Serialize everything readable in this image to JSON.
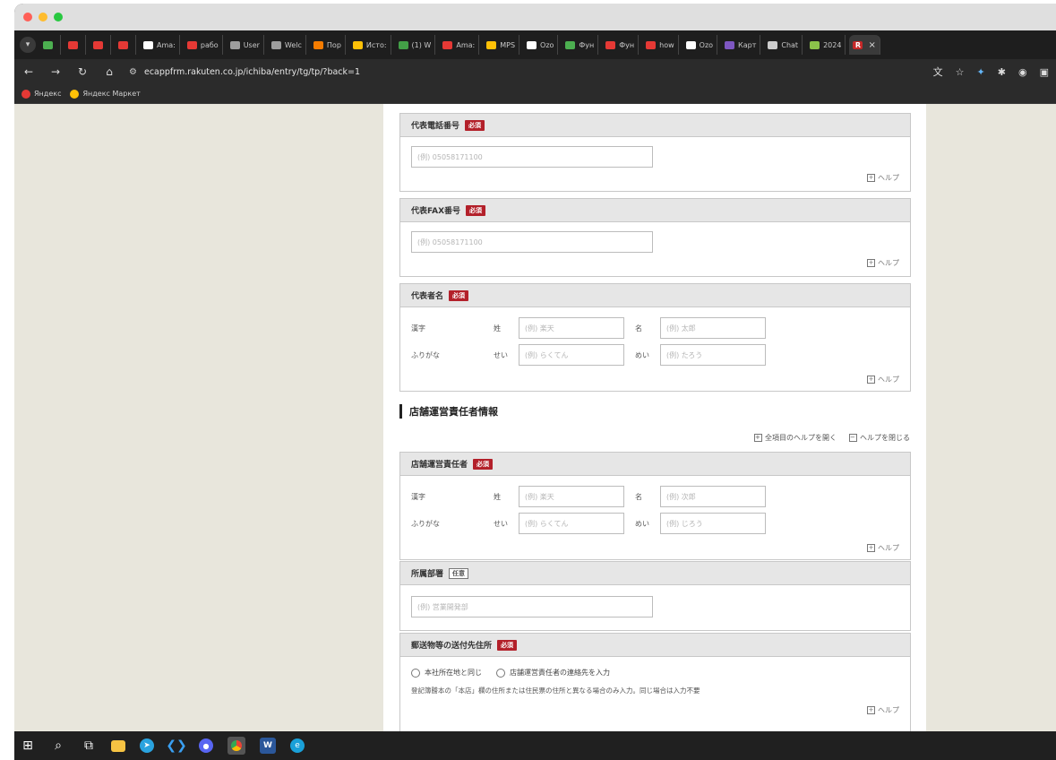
{
  "browser": {
    "tabs": [
      {
        "label": "",
        "color": "#4caf50"
      },
      {
        "label": "",
        "color": "#e53935"
      },
      {
        "label": "",
        "color": "#e53935"
      },
      {
        "label": "",
        "color": "#e53935"
      },
      {
        "label": "Ama:",
        "color": "#ffffff"
      },
      {
        "label": "рабо",
        "color": "#e53935"
      },
      {
        "label": "User",
        "color": "#9e9e9e"
      },
      {
        "label": "Welc",
        "color": "#9e9e9e"
      },
      {
        "label": "Пор",
        "color": "#f57c00"
      },
      {
        "label": "Исто:",
        "color": "#ffc107"
      },
      {
        "label": "(1) W",
        "color": "#43a047"
      },
      {
        "label": "Ama:",
        "color": "#e53935"
      },
      {
        "label": "MPS",
        "color": "#ffc107"
      },
      {
        "label": "Ozo",
        "color": "#ffffff"
      },
      {
        "label": "Фун",
        "color": "#4caf50"
      },
      {
        "label": "Фун",
        "color": "#e53935"
      },
      {
        "label": "how",
        "color": "#e53935"
      },
      {
        "label": "Ozo",
        "color": "#ffffff"
      },
      {
        "label": "Карт",
        "color": "#7e57c2"
      },
      {
        "label": "Chat",
        "color": "#cccccc"
      },
      {
        "label": "2024",
        "color": "#8bc34a"
      }
    ],
    "active_tab": {
      "label": "R",
      "color": "#c62828",
      "close": "×"
    },
    "url": "ecappfrm.rakuten.co.jp/ichiba/entry/tg/tp/?back=1",
    "bookmarks": [
      {
        "label": "Яндекс",
        "color": "#e53935"
      },
      {
        "label": "Яндекс Маркет",
        "color": "#ffc107"
      }
    ]
  },
  "form": {
    "phone": {
      "label": "代表電話番号",
      "badge": "必須",
      "placeholder": "(例) 05058171100",
      "help": "ヘルプ"
    },
    "fax": {
      "label": "代表FAX番号",
      "badge": "必須",
      "placeholder": "(例) 05058171100",
      "help": "ヘルプ"
    },
    "rep": {
      "label": "代表者名",
      "badge": "必須",
      "kanji_label": "漢字",
      "kana_label": "ふりがな",
      "sei": "姓",
      "mei": "名",
      "sei_kana": "せい",
      "mei_kana": "めい",
      "sei_ph": "(例) 楽天",
      "mei_ph": "(例) 太郎",
      "sei_kana_ph": "(例) らくてん",
      "mei_kana_ph": "(例) たろう",
      "help": "ヘルプ"
    },
    "section_title": "店舗運営責任者情報",
    "open_all": "全項目のヘルプを開く",
    "close_all": "ヘルプを閉じる",
    "manager": {
      "label": "店舗運営責任者",
      "badge": "必須",
      "kanji_label": "漢字",
      "kana_label": "ふりがな",
      "sei": "姓",
      "mei": "名",
      "sei_kana": "せい",
      "mei_kana": "めい",
      "sei_ph": "(例) 楽天",
      "mei_ph": "(例) 次郎",
      "sei_kana_ph": "(例) らくてん",
      "mei_kana_ph": "(例) じろう",
      "help": "ヘルプ"
    },
    "dept": {
      "label": "所属部署",
      "badge": "任意",
      "placeholder": "(例) 営業開発部"
    },
    "mail": {
      "label": "郵送物等の送付先住所",
      "badge": "必須",
      "option1": "本社所在地と同じ",
      "option2": "店舗運営責任者の連絡先を入力",
      "note": "登記簿謄本の「本店」欄の住所または住民票の住所と異なる場合のみ入力。同じ場合は入力不要",
      "help": "ヘルプ"
    }
  }
}
